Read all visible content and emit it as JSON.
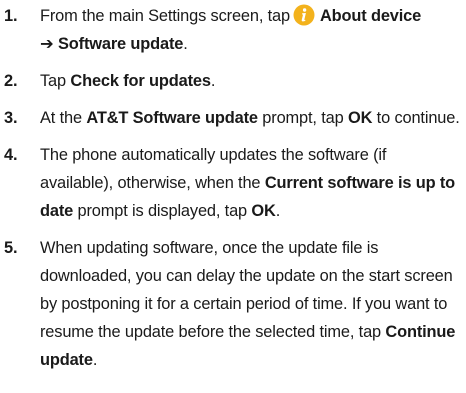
{
  "steps": [
    {
      "number": "1.",
      "pre": "From the main Settings screen, tap",
      "icon": "info-icon",
      "bold1": "About device",
      "bold2": "➔ Software update",
      "post": "."
    },
    {
      "number": "2.",
      "pre": "Tap ",
      "bold1": "Check for updates",
      "post": "."
    },
    {
      "number": "3.",
      "pre": "At the ",
      "bold1": "AT&T Software update",
      "mid": " prompt, tap ",
      "bold2": "OK",
      "post": " to continue."
    },
    {
      "number": "4.",
      "pre": "The phone automatically updates the software (if available), otherwise, when the ",
      "bold1": "Current software is up to date",
      "mid": " prompt is displayed, tap ",
      "bold2": "OK",
      "post": "."
    },
    {
      "number": "5.",
      "pre": "When updating software, once the update file is downloaded, you can delay the update on the start screen by postponing it for a certain period of time. If you want to resume the update before the selected time, tap ",
      "bold1": "Continue update",
      "post": "."
    }
  ],
  "colors": {
    "icon_fill": "#f3b21c",
    "icon_symbol": "#ffffff",
    "text": "#1a1a1a"
  }
}
